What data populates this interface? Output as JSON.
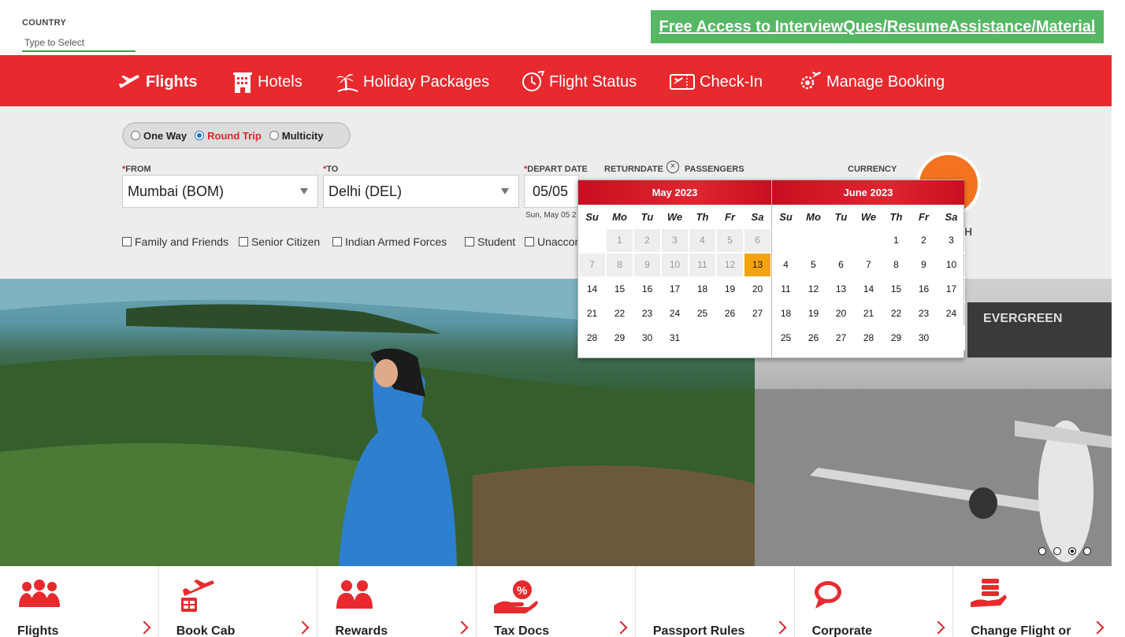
{
  "country": {
    "label": "COUNTRY",
    "placeholder": "Type to Select"
  },
  "promo": {
    "text": "Free Access to InterviewQues/ResumeAssistance/Material",
    "color": "#56b764"
  },
  "brand": {
    "primary": "#e82a2e",
    "accent": "#f37321",
    "selected_date": "#f5a30c"
  },
  "nav": [
    {
      "label": "Flights",
      "icon": "airplane-icon",
      "active": true
    },
    {
      "label": "Hotels",
      "icon": "hotel-building-icon"
    },
    {
      "label": "Holiday Packages",
      "icon": "palm-tree-icon"
    },
    {
      "label": "Flight Status",
      "icon": "clock-plane-icon"
    },
    {
      "label": "Check-In",
      "icon": "boarding-pass-icon"
    },
    {
      "label": "Manage Booking",
      "icon": "gear-plane-icon"
    }
  ],
  "trip": {
    "one_way": "One Way",
    "round_trip": "Round Trip",
    "multicity": "Multicity",
    "selected": "Round Trip"
  },
  "fields": {
    "from_label": "FROM",
    "from_value": "Mumbai (BOM)",
    "to_label": "TO",
    "to_value": "Delhi (DEL)",
    "depart_label": "DEPART DATE",
    "depart_value": "05/05",
    "depart_note": "Sun, May 05 2",
    "return_label": "RETURNDATE",
    "passengers_label": "PASSENGERS",
    "currency_label": "CURRENCY",
    "search_tail": "H"
  },
  "concessions": [
    "Family and Friends",
    "Senior Citizen",
    "Indian Armed Forces",
    "Student",
    "Unaccom"
  ],
  "calendar": {
    "weekdays": [
      "Su",
      "Mo",
      "Tu",
      "We",
      "Th",
      "Fr",
      "Sa"
    ],
    "months": [
      {
        "title": "May 2023",
        "lead_blank": 1,
        "days": 31,
        "disabled_until": 12,
        "selected": 13
      },
      {
        "title": "June 2023",
        "lead_blank": 4,
        "days": 30,
        "disabled_until": 0,
        "selected": null
      }
    ]
  },
  "carousel": {
    "count": 4,
    "active": 3
  },
  "cards": [
    {
      "title": "Flights",
      "icon": "group-people-icon"
    },
    {
      "title": "Book Cab",
      "icon": "cab-plane-icon"
    },
    {
      "title": "Rewards",
      "icon": "rewards-people-icon"
    },
    {
      "title": "Tax Docs",
      "icon": "percent-hand-icon"
    },
    {
      "title": "Passport Rules",
      "icon": "passport-icon"
    },
    {
      "title": "Corporate",
      "icon": "speech-bubble-icon"
    },
    {
      "title": "Change Flight or",
      "icon": "change-flight-icon"
    }
  ]
}
